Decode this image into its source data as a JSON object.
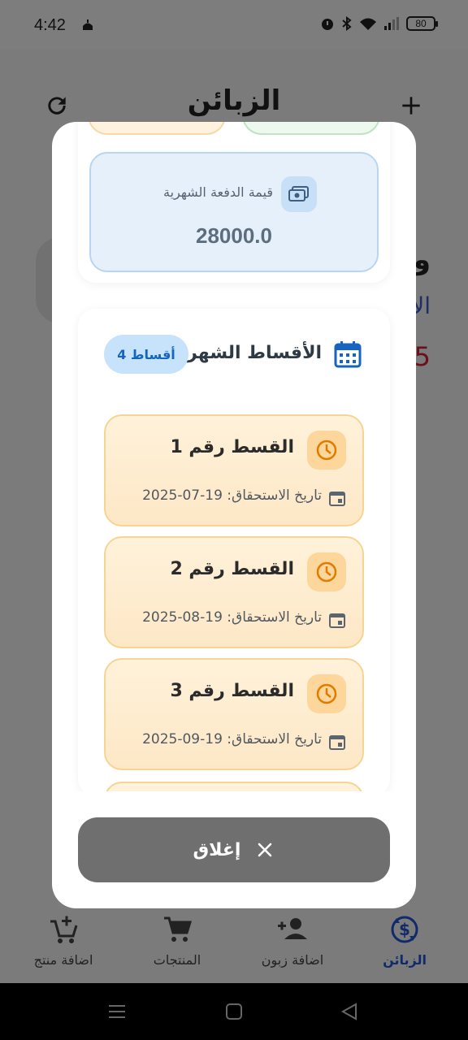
{
  "status_bar": {
    "time": "4:42",
    "battery": "80"
  },
  "header": {
    "title": "الزبائن"
  },
  "background": {
    "text_1": "و",
    "text_2": "الا",
    "text_3": "(5"
  },
  "dialog": {
    "payment": {
      "label": "قيمة الدفعة الشهرية",
      "value": "28000.0"
    },
    "installments": {
      "title": "الأقساط الشهرية",
      "badge": "4 أقساط",
      "items": [
        {
          "name": "القسط رقم 1",
          "due": "تاريخ الاستحقاق: 19-07-2025"
        },
        {
          "name": "القسط رقم 2",
          "due": "تاريخ الاستحقاق: 19-08-2025"
        },
        {
          "name": "القسط رقم 3",
          "due": "تاريخ الاستحقاق: 19-09-2025"
        }
      ]
    },
    "close_label": "إغلاق"
  },
  "bottom_nav": [
    {
      "label": "الزبائن",
      "icon": "currency-exchange-icon",
      "active": true
    },
    {
      "label": "اضافة زبون",
      "icon": "person-add-icon",
      "active": false
    },
    {
      "label": "المنتجات",
      "icon": "cart-icon",
      "active": false
    },
    {
      "label": "اضافة منتج",
      "icon": "add-shopping-cart-icon",
      "active": false
    }
  ],
  "colors": {
    "accent_blue": "#1565c0",
    "installment_bg": "#fde8c6",
    "installment_border": "#f6d493",
    "payment_bg": "#e6f0fb"
  }
}
